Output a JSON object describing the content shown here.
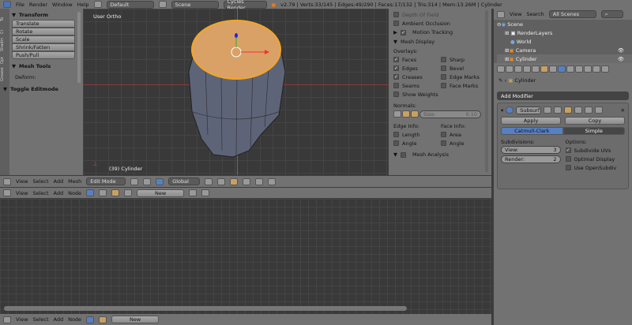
{
  "topbar": {
    "menus": [
      "File",
      "Render",
      "Window",
      "Help"
    ],
    "layout": "Default",
    "scene": "Scene",
    "engine": "Cycles Render",
    "stats": "v2.79 | Verts:33/145 | Edges:49/290 | Faces:17/132 | Tris:314 | Mem:13.26M | Cylinder"
  },
  "toolshelf": {
    "tabs": [
      "To",
      "Cr",
      "Shadin",
      "Opt",
      "Grease"
    ],
    "transform_title": "Transform",
    "buttons": [
      "Translate",
      "Rotate",
      "Scale",
      "Shrink/Fatten",
      "Push/Pull"
    ],
    "mesh_tools_title": "Mesh Tools",
    "deform_label": "Deform:",
    "toggle_editmode": "Toggle Editmode"
  },
  "viewport": {
    "view_label": "User Ortho",
    "object_label": "(39) Cylinder"
  },
  "npanel": {
    "depth_of_field": "Depth Of Field",
    "ambient_occlusion": "Ambient Occlusion",
    "motion_tracking": "Motion Tracking",
    "mesh_display": "Mesh Display",
    "overlays_label": "Overlays:",
    "overlays_left": [
      {
        "label": "Faces",
        "checked": true
      },
      {
        "label": "Edges",
        "checked": true
      },
      {
        "label": "Creases",
        "checked": true
      },
      {
        "label": "Seams",
        "checked": false
      }
    ],
    "overlays_right": [
      {
        "label": "Sharp",
        "checked": false
      },
      {
        "label": "Bevel",
        "checked": false
      },
      {
        "label": "Edge Marks",
        "checked": false
      },
      {
        "label": "Face Marks",
        "checked": false
      }
    ],
    "show_weights": "Show Weights",
    "normals_label": "Normals:",
    "size_label": "Size:",
    "size_value": "0.10",
    "edge_info": "Edge Info:",
    "face_info": "Face Info:",
    "edge_items": [
      "Length",
      "Angle"
    ],
    "face_items": [
      "Area",
      "Angle"
    ],
    "mesh_analysis": "Mesh Analysis"
  },
  "view3d_header": {
    "menus": [
      "View",
      "Select",
      "Add",
      "Mesh"
    ],
    "mode": "Edit Mode",
    "orientation": "Global"
  },
  "node_header": {
    "menus": [
      "View",
      "Select",
      "Add",
      "Node"
    ],
    "new_label": "New"
  },
  "node_header_bottom": {
    "menus": [
      "View",
      "Select",
      "Add",
      "Node"
    ],
    "new_label": "New"
  },
  "outliner": {
    "menus": [
      "View",
      "Search"
    ],
    "filter": "All Scenes",
    "items": [
      "Scene",
      "RenderLayers",
      "World",
      "Camera",
      "Cylinder"
    ]
  },
  "properties": {
    "breadcrumb": "Cylinder",
    "add_modifier": "Add Modifier",
    "modifier_name": "Subsurf",
    "apply": "Apply",
    "copy": "Copy",
    "tabs": [
      "Catmull-Clark",
      "Simple"
    ],
    "subdivisions_label": "Subdivisions:",
    "view_label": "View:",
    "view_value": "3",
    "render_label": "Render:",
    "render_value": "2",
    "options_label": "Options:",
    "options": [
      {
        "label": "Subdivide UVs",
        "checked": true
      },
      {
        "label": "Optimal Display",
        "checked": false
      },
      {
        "label": "Use OpenSubdiv",
        "checked": false
      }
    ]
  },
  "colors": {
    "accent": "#5680c2",
    "selection": "#f5a623"
  }
}
